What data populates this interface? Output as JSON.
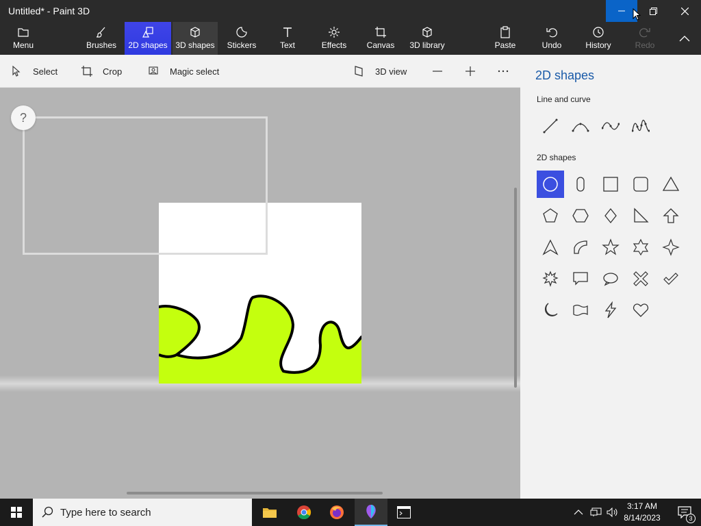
{
  "window": {
    "title": "Untitled* - Paint 3D"
  },
  "ribbon": {
    "menu": "Menu",
    "brushes": "Brushes",
    "shapes2d": "2D shapes",
    "shapes3d": "3D shapes",
    "stickers": "Stickers",
    "text": "Text",
    "effects": "Effects",
    "canvas": "Canvas",
    "library3d": "3D library",
    "paste": "Paste",
    "undo": "Undo",
    "history": "History",
    "redo": "Redo"
  },
  "toolbar": {
    "select": "Select",
    "crop": "Crop",
    "magic_select": "Magic select",
    "view3d": "3D view"
  },
  "help": {
    "label": "?"
  },
  "panel": {
    "title": "2D shapes",
    "section_lines": "Line and curve",
    "section_shapes": "2D shapes",
    "selected_shape": "circle"
  },
  "taskbar": {
    "search_placeholder": "Type here to search",
    "time": "3:17 AM",
    "date": "8/14/2023",
    "notifications": "3"
  },
  "colors": {
    "accent": "#3b4fe0",
    "fill": "#c4ff0e",
    "panel_title": "#1a5aa8"
  }
}
